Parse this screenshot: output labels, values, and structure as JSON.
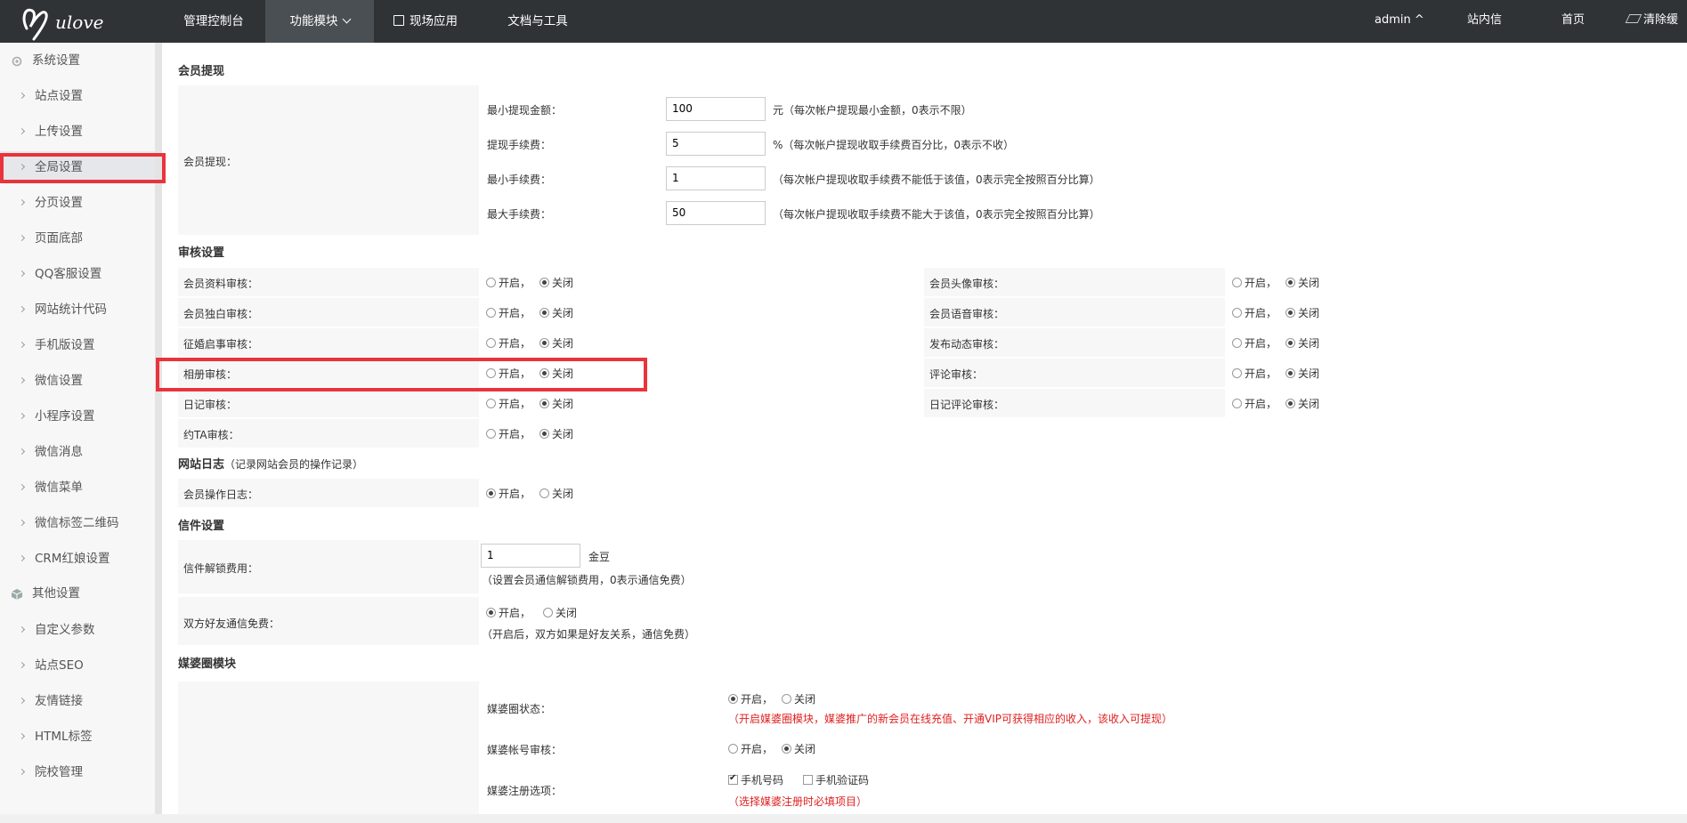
{
  "topbar": {
    "nav": [
      "管理控制台",
      "功能模块",
      "现场应用",
      "文档与工具"
    ],
    "right": [
      "admin ^",
      "站内信",
      "首页",
      "清除缓存"
    ]
  },
  "sidebar": {
    "group1": "系统设置",
    "items1": [
      "站点设置",
      "上传设置",
      "全局设置",
      "分页设置",
      "页面底部",
      "QQ客服设置",
      "网站统计代码",
      "手机版设置",
      "微信设置",
      "小程序设置",
      "微信消息",
      "微信菜单",
      "微信标签二维码",
      "CRM红娘设置"
    ],
    "group2": "其他设置",
    "items2": [
      "自定义参数",
      "站点SEO",
      "友情链接",
      "HTML标签",
      "院校管理"
    ]
  },
  "withdraw": {
    "title": "会员提现",
    "row_label": "会员提现：",
    "fields": [
      {
        "label": "最小提现金额：",
        "value": "100",
        "note": "元（每次帐户提现最小金额，0表示不限）"
      },
      {
        "label": "提现手续费：",
        "value": "5",
        "note": "%（每次帐户提现收取手续费百分比，0表示不收）"
      },
      {
        "label": "最小手续费：",
        "value": "1",
        "note": "（每次帐户提现收取手续费不能低于该值，0表示完全按照百分比算）"
      },
      {
        "label": "最大手续费：",
        "value": "50",
        "note": "（每次帐户提现收取手续费不能大于该值，0表示完全按照百分比算）"
      }
    ]
  },
  "audit": {
    "title": "审核设置",
    "on": "开启，",
    "off": "关闭",
    "left": [
      "会员资料审核：",
      "会员独白审核：",
      "征婚启事审核：",
      "相册审核：",
      "日记审核：",
      "约TA审核："
    ],
    "right": [
      "会员头像审核：",
      "会员语音审核：",
      "发布动态审核：",
      "评论审核：",
      "日记评论审核："
    ]
  },
  "log": {
    "title": "网站日志",
    "sub": "（记录网站会员的操作记录）",
    "label": "会员操作日志：",
    "on": "开启，",
    "off": "关闭"
  },
  "mail": {
    "title": "信件设置",
    "unlock_label": "信件解锁费用：",
    "unlock_value": "1",
    "unlock_unit": "金豆",
    "unlock_note": "（设置会员通信解锁费用，0表示通信免费）",
    "friend_label": "双方好友通信免费：",
    "on": "开启，",
    "off": "关闭",
    "friend_note": "（开启后，双方如果是好友关系，通信免费）"
  },
  "matchmaker": {
    "title": "媒婆圈模块",
    "status_label": "媒婆圈状态：",
    "on": "开启，",
    "off": "关闭",
    "status_note": "（开启媒婆圈模块，媒婆推广的新会员在线充值、开通VIP可获得相应的收入，该收入可提现）",
    "account_label": "媒婆帐号审核：",
    "reg_label": "媒婆注册选项：",
    "reg_opt1": "手机号码",
    "reg_opt2": "手机验证码",
    "reg_note": "（选择媒婆注册时必填项目）"
  }
}
